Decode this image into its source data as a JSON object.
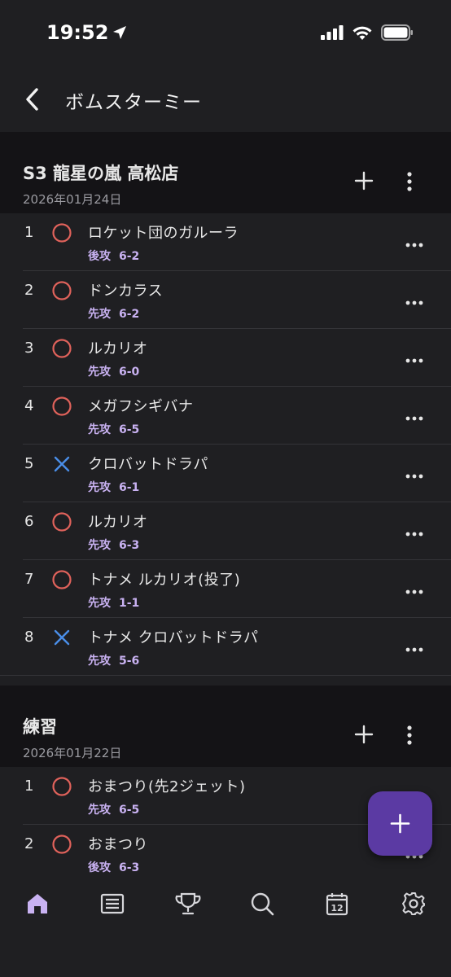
{
  "status_bar": {
    "time": "19:52",
    "icons": [
      "location-arrow-icon",
      "cellular-signal-icon",
      "wifi-icon",
      "battery-icon"
    ]
  },
  "nav": {
    "title": "ボムスターミー",
    "back_icon": "chevron-left-icon"
  },
  "groups": [
    {
      "title": "S3 龍星の嵐 高松店",
      "date": "2026年01月24日",
      "matches": [
        {
          "num": "1",
          "result": "win",
          "name": "ロケット団のガルーラ",
          "order": "後攻",
          "score": "6-2"
        },
        {
          "num": "2",
          "result": "win",
          "name": "ドンカラス",
          "order": "先攻",
          "score": "6-2"
        },
        {
          "num": "3",
          "result": "win",
          "name": "ルカリオ",
          "order": "先攻",
          "score": "6-0"
        },
        {
          "num": "4",
          "result": "win",
          "name": "メガフシギバナ",
          "order": "先攻",
          "score": "6-5"
        },
        {
          "num": "5",
          "result": "loss",
          "name": "クロバットドラパ",
          "order": "先攻",
          "score": "6-1"
        },
        {
          "num": "6",
          "result": "win",
          "name": "ルカリオ",
          "order": "先攻",
          "score": "6-3"
        },
        {
          "num": "7",
          "result": "win",
          "name": "トナメ ルカリオ(投了)",
          "order": "先攻",
          "score": "1-1"
        },
        {
          "num": "8",
          "result": "loss",
          "name": "トナメ クロバットドラパ",
          "order": "先攻",
          "score": "5-6"
        }
      ]
    },
    {
      "title": "練習",
      "date": "2026年01月22日",
      "matches": [
        {
          "num": "1",
          "result": "win",
          "name": "おまつり(先2ジェット)",
          "order": "先攻",
          "score": "6-5"
        },
        {
          "num": "2",
          "result": "win",
          "name": "おまつり",
          "order": "後攻",
          "score": "6-3"
        }
      ]
    }
  ],
  "colors": {
    "background": "#1f1f22",
    "group_header": "#141316",
    "win_mark": "#e0625b",
    "loss_mark": "#4a8ee8",
    "accent_text": "#c9b2f2",
    "fab": "#5b3aa3",
    "active_tab": "#c9b2f2"
  },
  "fab": {
    "icon": "plus-icon"
  },
  "tabbar": {
    "tabs": [
      {
        "icon": "home-icon",
        "active": true
      },
      {
        "icon": "list-icon",
        "active": false
      },
      {
        "icon": "trophy-icon",
        "active": false
      },
      {
        "icon": "search-icon",
        "active": false
      },
      {
        "icon": "calendar-icon",
        "active": false,
        "text": "12"
      },
      {
        "icon": "gear-icon",
        "active": false
      }
    ]
  }
}
